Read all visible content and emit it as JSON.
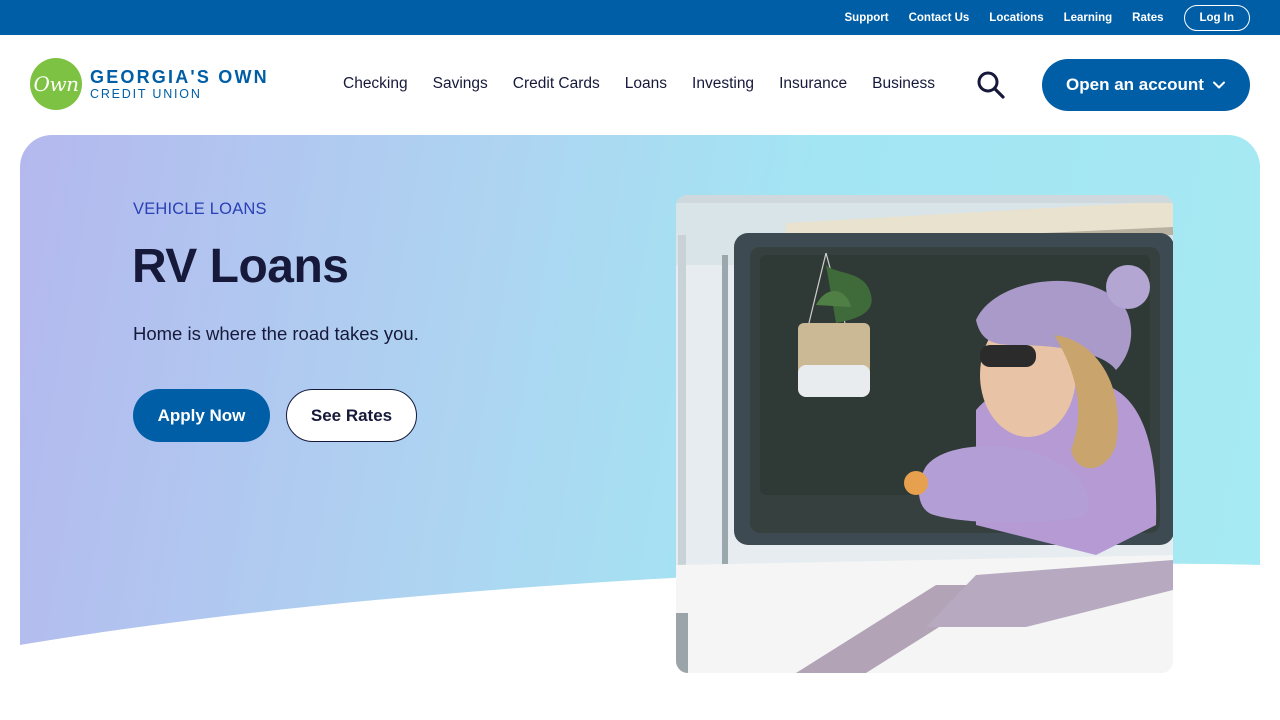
{
  "utility": {
    "links": [
      "Support",
      "Contact Us",
      "Locations",
      "Learning",
      "Rates"
    ],
    "login_label": "Log In"
  },
  "header": {
    "logo_mark": "Own",
    "logo_name": "GEORGIA'S OWN",
    "logo_sub": "CREDIT UNION",
    "nav": [
      "Checking",
      "Savings",
      "Credit Cards",
      "Loans",
      "Investing",
      "Insurance",
      "Business"
    ],
    "open_account_label": "Open an account"
  },
  "hero": {
    "eyebrow": "VEHICLE LOANS",
    "title": "RV Loans",
    "subtitle": "Home is where the road takes you.",
    "apply_label": "Apply Now",
    "rates_label": "See Rates"
  },
  "colors": {
    "brand_blue": "#005ea6",
    "logo_green": "#7dc242",
    "heading_navy": "#16193a",
    "eyebrow_blue": "#2a40b4"
  },
  "icons": {
    "search": "search-icon",
    "chevron": "chevron-down-icon"
  }
}
